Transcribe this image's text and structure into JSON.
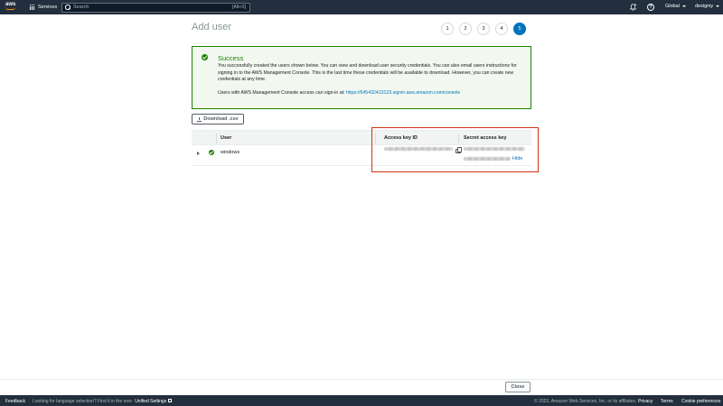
{
  "topnav": {
    "logo_text": "aws",
    "services_label": "Services",
    "search_placeholder": "Search",
    "search_shortcut": "[Alt+S]",
    "region_label": "Global",
    "account_label": "designiy",
    "icons": [
      "grid-icon",
      "search-icon",
      "bell-icon",
      "help-icon"
    ]
  },
  "page": {
    "title": "Add user",
    "steps": [
      "1",
      "2",
      "3",
      "4",
      "5"
    ],
    "active_step": "5"
  },
  "success": {
    "title": "Success",
    "message": "You successfully created the users shown below. You can view and download user security credentials. You can also email users instructions for signing in to the AWS Management Console. This is the last time these credentials will be available to download. However, you can create new credentials at any time.",
    "signin_prefix": "Users with AWS Management Console access can sign-in at:",
    "signin_url": "https://645432413123.signin.aws.amazon.com/console"
  },
  "actions": {
    "download_label": "Download .csv",
    "close_label": "Close"
  },
  "table": {
    "columns": {
      "user": "User",
      "access_key_id": "Access key ID",
      "secret_access_key": "Secret access key"
    },
    "rows": [
      {
        "user": "windows",
        "secret_toggle": "Hide"
      }
    ]
  },
  "footer": {
    "feedback": "Feedback",
    "lang_prompt": "Looking for language selection? Find it in the new",
    "unified_settings": "Unified Settings",
    "copyright": "© 2023, Amazon Web Services, Inc. or its affiliates.",
    "privacy": "Privacy",
    "terms": "Terms",
    "cookie": "Cookie preferences"
  },
  "colors": {
    "nav_bg": "#232f3e",
    "accent": "#0073bb",
    "success": "#1d8102",
    "highlight": "#d13212",
    "aws_orange": "#ff9900"
  }
}
